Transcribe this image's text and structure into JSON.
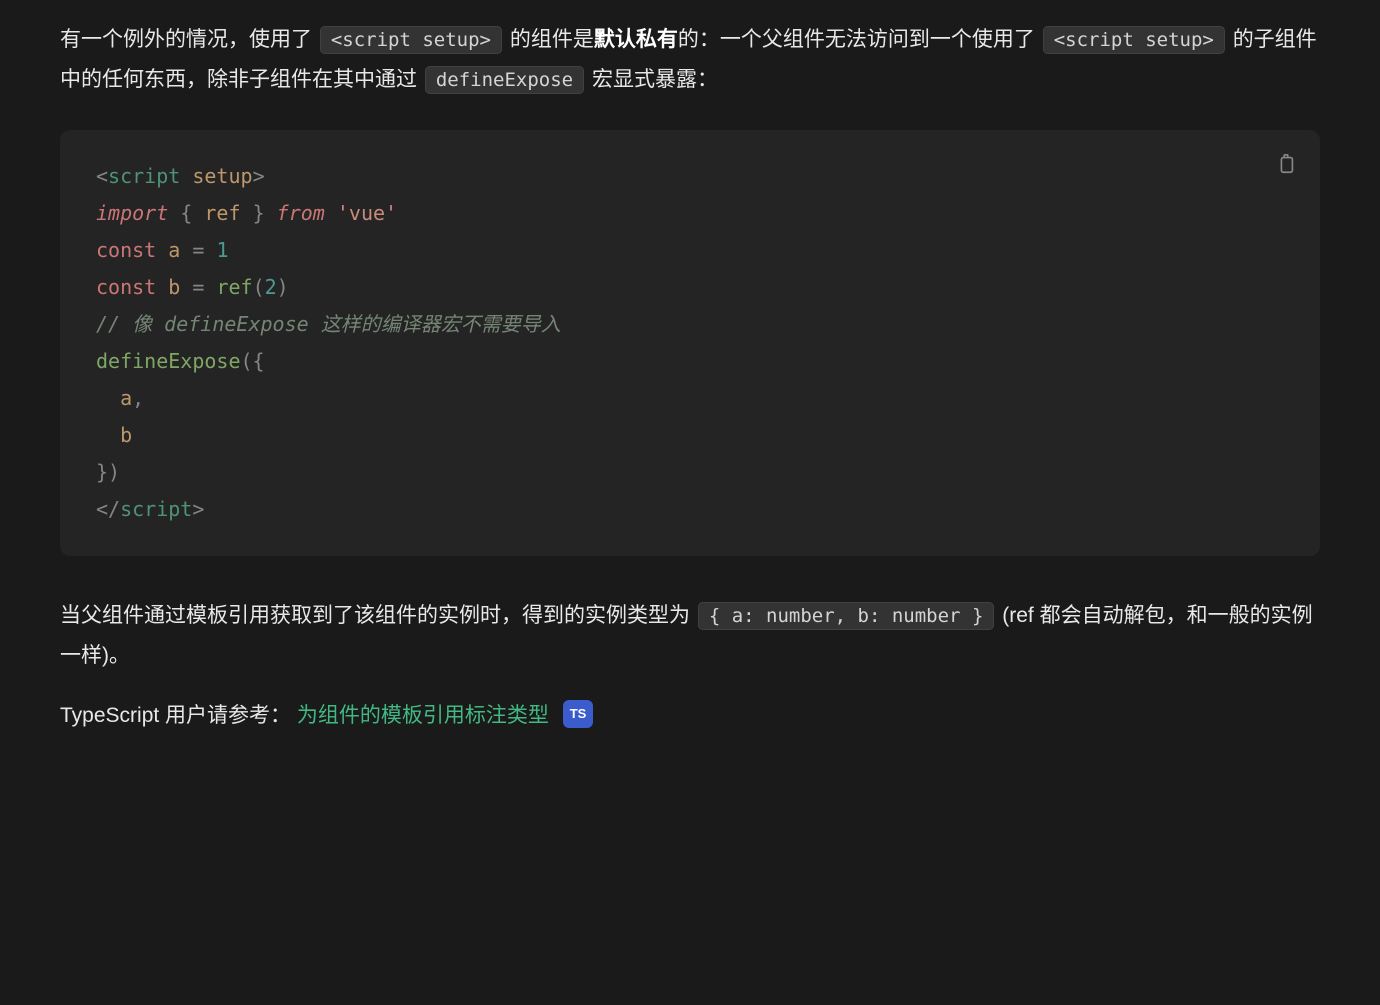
{
  "para1": {
    "t1": "有一个例外的情况，使用了 ",
    "code1": "<script setup>",
    "t2": " 的组件是",
    "bold": "默认私有",
    "t3": "的：一个父组件无法访问到一个使用了 ",
    "code2": "<script setup>",
    "t4": " 的子组件中的任何东西，除非子组件在其中通过 ",
    "code3": "defineExpose",
    "t5": " 宏显式暴露："
  },
  "code": {
    "l1": {
      "p1": "<",
      "tag": "script",
      "sp": " ",
      "attr": "setup",
      "p2": ">"
    },
    "l2": {
      "kw": "import",
      "sp1": " ",
      "p1": "{",
      "sp2": " ",
      "v": "ref",
      "sp3": " ",
      "p2": "}",
      "sp4": " ",
      "from": "from",
      "sp5": " ",
      "str": "'vue'"
    },
    "l3": "",
    "l4": {
      "kw": "const",
      "sp1": " ",
      "v": "a",
      "sp2": " ",
      "eq": "=",
      "sp3": " ",
      "num": "1"
    },
    "l5": {
      "kw": "const",
      "sp1": " ",
      "v": "b",
      "sp2": " ",
      "eq": "=",
      "sp3": " ",
      "fn": "ref",
      "p1": "(",
      "num": "2",
      "p2": ")"
    },
    "l6": "",
    "l7": "// 像 defineExpose 这样的编译器宏不需要导入",
    "l8": {
      "fn": "defineExpose",
      "p1": "(",
      "p2": "{"
    },
    "l9": {
      "indent": "  ",
      "v": "a",
      "p": ","
    },
    "l10": {
      "indent": "  ",
      "v": "b"
    },
    "l11": {
      "p1": "}",
      "p2": ")"
    },
    "l12": {
      "p1": "</",
      "tag": "script",
      "p2": ">"
    }
  },
  "para2": {
    "t1": "当父组件通过模板引用获取到了该组件的实例时，得到的实例类型为 ",
    "code1": "{ a: number, b: number }",
    "t2": " (ref 都会自动解包，和一般的实例一样)。"
  },
  "para3": {
    "t1": "TypeScript 用户请参考：",
    "link": "为组件的模板引用标注类型",
    "badge": "TS"
  }
}
